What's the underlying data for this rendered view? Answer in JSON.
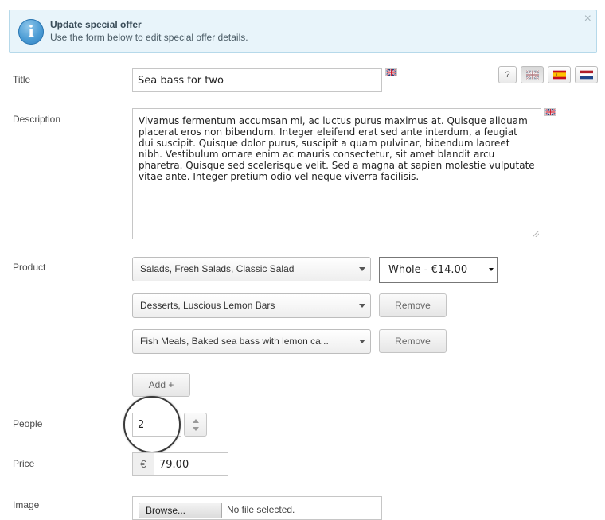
{
  "banner": {
    "title": "Update special offer",
    "subtitle": "Use the form below to edit special offer details.",
    "icon": "info-icon",
    "close": "×"
  },
  "languages": [
    {
      "code": "en",
      "icon": "uk-flag-icon",
      "active": true
    },
    {
      "code": "es",
      "icon": "spain-flag-icon",
      "active": false
    },
    {
      "code": "nl",
      "icon": "netherlands-flag-icon",
      "active": false
    }
  ],
  "help_button": "?",
  "form": {
    "title_label": "Title",
    "title_value": "Sea bass for two",
    "description_label": "Description",
    "description_value": "Vivamus fermentum accumsan mi, ac luctus purus maximus at. Quisque aliquam placerat eros non bibendum. Integer eleifend erat sed ante interdum, a feugiat dui suscipit. Quisque dolor purus, suscipit a quam pulvinar, bibendum laoreet nibh. Vestibulum ornare enim ac mauris consectetur, sit amet blandit arcu pharetra. Quisque sed scelerisque velit. Sed a magna at sapien molestie vulputate vitae ante. Integer pretium odio vel neque viverra facilisis.",
    "product_label": "Product",
    "products": [
      {
        "value": "Salads, Fresh Salads, Classic Salad",
        "variant": "Whole - €14.00"
      },
      {
        "value": "Desserts, Luscious Lemon Bars",
        "action": "Remove"
      },
      {
        "value": "Fish Meals, Baked sea bass with lemon ca...",
        "action": "Remove"
      }
    ],
    "add_label": "Add +",
    "people_label": "People",
    "people_value": "2",
    "price_label": "Price",
    "currency_symbol": "€",
    "price_value": "79.00",
    "image_label": "Image",
    "browse_label": "Browse...",
    "no_file_label": "No file selected."
  }
}
